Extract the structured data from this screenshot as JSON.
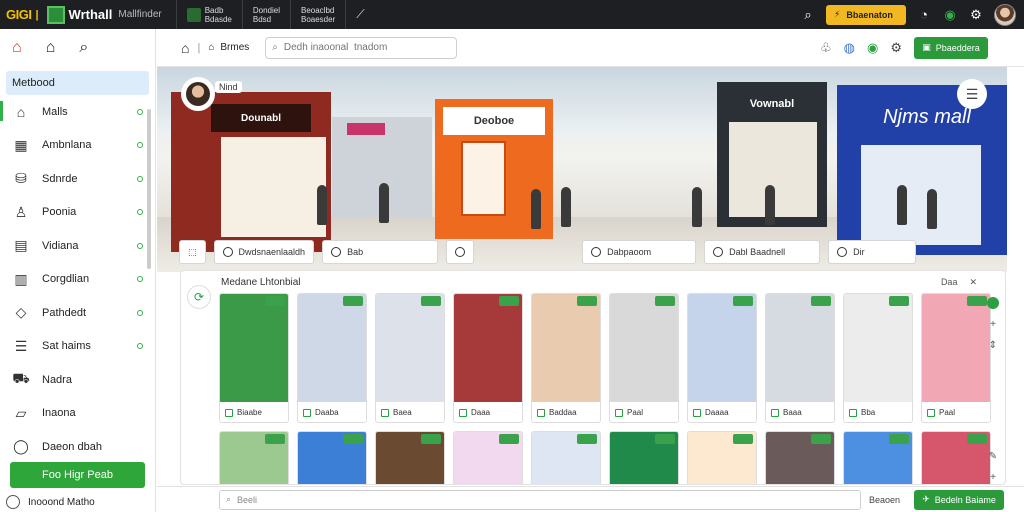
{
  "colors": {
    "accent_green": "#2b9a3a",
    "topbar": "#1d1f22",
    "upgrade_yellow": "#f2b821",
    "active_bg": "#dcecfb"
  },
  "topbar": {
    "logo_text": "GIGI",
    "brand": "Wrthall",
    "brand_sub": "Mallfinder",
    "nav": [
      {
        "line1": "Badb",
        "line2": "Bdasde"
      },
      {
        "line1": "Dondiel",
        "line2": "Bdsd"
      },
      {
        "line1": "Beoaclbd",
        "line2": "Boaesder"
      }
    ],
    "upgrade_label": "Bbaenaton"
  },
  "sidebar": {
    "items": [
      {
        "label": "Metbood",
        "icon": "grid-icon"
      },
      {
        "label": "Malls",
        "icon": "store-icon"
      },
      {
        "label": "Ambnlana",
        "icon": "map-icon"
      },
      {
        "label": "Sdnrde",
        "icon": "bag-icon"
      },
      {
        "label": "Poonia",
        "icon": "users-icon"
      },
      {
        "label": "Vidiana",
        "icon": "book-icon"
      },
      {
        "label": "Corgdlian",
        "icon": "chart-icon"
      },
      {
        "label": "Pathdedt",
        "icon": "tag-icon"
      },
      {
        "label": "Sat haims",
        "icon": "list-icon"
      },
      {
        "label": "Nadra",
        "icon": "cart-icon"
      },
      {
        "label": "Inaona",
        "icon": "folder-icon"
      },
      {
        "label": "Daeon dbah",
        "icon": "chat-icon"
      }
    ],
    "cta_label": "Foo Higr Peab",
    "footer_label": "Inooond Matho"
  },
  "toolbar": {
    "crumb": "Brmes",
    "search_placeholder": "Dedh inaoonal  tnadom",
    "publish_label": "Pbaeddera"
  },
  "hero": {
    "tag": "Nind",
    "store_signs": [
      "Dounabl",
      "Deoboe",
      "Vownabl",
      "Njms mall"
    ],
    "chips": [
      "Dwdsnaenlaaldh",
      "Bab",
      "",
      "Dabpaoom",
      "Dabl Baadnell",
      "Dir"
    ]
  },
  "panel": {
    "title": "Medane Lhtonbial",
    "actions": [
      "Daa",
      "✕"
    ],
    "cards": [
      {
        "label": "Biaabe",
        "bg": "#3a9a48"
      },
      {
        "label": "Daaba",
        "bg": "#cfd8e6"
      },
      {
        "label": "Baea",
        "bg": "#dde2ea"
      },
      {
        "label": "Daaa",
        "bg": "#a63a3a"
      },
      {
        "label": "Baddaa",
        "bg": "#e9cbb0"
      },
      {
        "label": "Paal",
        "bg": "#d9d9d9"
      },
      {
        "label": "Daaaa",
        "bg": "#c5d4ea"
      },
      {
        "label": "Baaa",
        "bg": "#d6dbe2"
      },
      {
        "label": "Bba",
        "bg": "#ececec"
      },
      {
        "label": "Paal",
        "bg": "#f1a7b4"
      }
    ],
    "cards_row2_bg": [
      "#9cc98f",
      "#3c7fd6",
      "#6b4a32",
      "#f2d9f0",
      "#dde6f2",
      "#1f8a4a",
      "#fde9d0",
      "#6a5a5a",
      "#4d8fe0",
      "#d6576b"
    ]
  },
  "bottombar": {
    "input_placeholder": "Beeli",
    "cancel_label": "Beaoen",
    "submit_label": "Bedeln Baiame"
  }
}
